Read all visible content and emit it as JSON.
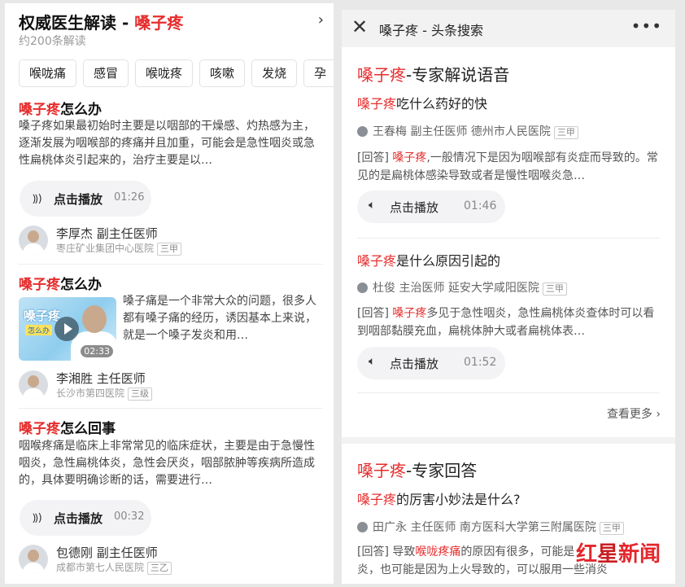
{
  "left": {
    "title_prefix": "权威医生解读 - ",
    "title_highlight": "嗓子疼",
    "subtitle": "约200条解读",
    "chips": [
      "喉咙痛",
      "感冒",
      "喉咙疼",
      "咳嗽",
      "发烧",
      "孕"
    ],
    "cards": [
      {
        "q_hl": "嗓子疼",
        "q_rest": "怎么办",
        "answer": "嗓子疼如果最初始时主要是以咽部的干燥感、灼热感为主，逐渐发展为咽喉部的疼痛并且加重，可能会是急性咽炎或急性扁桃体炎引起来的，治疗主要是以…",
        "audio_label": "点击播放",
        "audio_duration": "01:26",
        "doctor": "李厚杰 副主任医师",
        "hospital": "枣庄矿业集团中心医院",
        "level": "三甲"
      },
      {
        "q_hl": "嗓子疼",
        "q_rest": "怎么办",
        "answer": "嗓子痛是一个非常大众的问题，很多人都有嗓子痛的经历，诱因基本上来说，就是一个嗓子发炎和用…",
        "video_text1": "嗓子疼",
        "video_text2": "怎么办",
        "video_duration": "02:33",
        "doctor": "李湘胜 主任医师",
        "hospital": "长沙市第四医院",
        "level": "三级"
      },
      {
        "q_hl": "嗓子疼",
        "q_rest": "怎么回事",
        "answer": "咽喉疼痛是临床上非常常见的临床症状，主要是由于急慢性咽炎，急性扁桃体炎，急性会厌炎，咽部脓肿等疾病所造成的，具体要明确诊断的话，需要进行…",
        "audio_label": "点击播放",
        "audio_duration": "00:32",
        "doctor": "包德刚 副主任医师",
        "hospital": "成都市第七人民医院",
        "level": "三乙"
      }
    ]
  },
  "right": {
    "topbar_title": "嗓子疼 - 头条搜索",
    "section1_hl": "嗓子疼",
    "section1_rest": "-专家解说语音",
    "items": [
      {
        "q_hl": "嗓子疼",
        "q_rest": "吃什么药好的快",
        "doctor": "王春梅 副主任医师 德州市人民医院",
        "level": "三甲",
        "answer_prefix": "[回答] ",
        "answer_hl": "嗓子疼",
        "answer_rest": ",一般情况下是因为咽喉部有炎症而导致的。常见的是扁桃体感染导致或者是慢性咽喉炎急…",
        "audio_label": "点击播放",
        "audio_duration": "01:46"
      },
      {
        "q_hl": "嗓子疼",
        "q_rest": "是什么原因引起的",
        "doctor": "杜俊 主治医师 延安大学咸阳医院",
        "level": "三甲",
        "answer_prefix": "[回答] ",
        "answer_hl": "嗓子疼",
        "answer_rest": "多见于急性咽炎，急性扁桃体炎查体时可以看到咽部黏膜充血，扁桃体肿大或者扁桃体表…",
        "audio_label": "点击播放",
        "audio_duration": "01:52"
      }
    ],
    "see_more": "查看更多",
    "section2_hl": "嗓子疼",
    "section2_rest": "-专家回答",
    "item3": {
      "q_hl": "嗓子疼",
      "q_rest": "的厉害小妙法是什么?",
      "doctor": "田广永 主任医师 南方医科大学第三附属医院",
      "level": "三甲",
      "answer_prefix": "[回答] 导致",
      "answer_hl": "喉咙疼痛",
      "answer_rest": "的原因有很多，可能是",
      "answer_line2": "炎，也可能是因为上火导致的，可以服用一些消炎"
    }
  },
  "watermark": {
    "part1": "红",
    "part2": "星",
    "part3": "新闻"
  },
  "colors": {
    "highlight": "#e62c2c",
    "watermark": "#e3272c"
  }
}
